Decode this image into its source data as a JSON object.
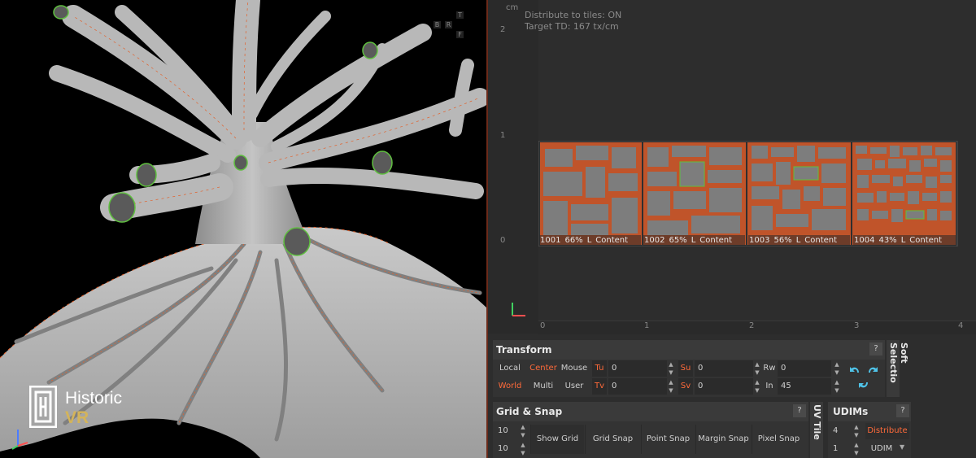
{
  "brand": {
    "name_line1": "Historic",
    "name_line2": "VR"
  },
  "viewport3d": {
    "corner_buttons": [
      "B",
      "T",
      "F",
      "R"
    ],
    "axis_icon": "xyz-axis-icon"
  },
  "uv_editor": {
    "unit_label": "cm",
    "info_lines": [
      "Distribute to tiles: ON",
      "Target TD: 167 tx/cm"
    ],
    "v_ticks": [
      "2",
      "1",
      "0"
    ],
    "u_ticks": [
      "0",
      "1",
      "2",
      "3",
      "4"
    ],
    "tiles": [
      {
        "id": "1001",
        "pct": "66%",
        "flag": "L",
        "name": "Content"
      },
      {
        "id": "1002",
        "pct": "65%",
        "flag": "L",
        "name": "Content"
      },
      {
        "id": "1003",
        "pct": "56%",
        "flag": "L",
        "name": "Content"
      },
      {
        "id": "1004",
        "pct": "43%",
        "flag": "L",
        "name": "Content"
      }
    ],
    "colors": {
      "island_fill": "#7d7d7d",
      "seam": "#e2622d",
      "selection": "#5fbf3f",
      "background": "#2d2d2d"
    }
  },
  "transform_panel": {
    "title": "Transform",
    "help": "?",
    "row1": {
      "space": "Local",
      "pivot": "Center",
      "mode": "Mouse",
      "tu_label": "Tu",
      "tu_value": "0",
      "su_label": "Su",
      "su_value": "0",
      "rw_label": "Rw",
      "rw_value": "0"
    },
    "row2": {
      "space": "World",
      "pivot": "Multi",
      "mode": "User",
      "tv_label": "Tv",
      "tv_value": "0",
      "sv_label": "Sv",
      "sv_value": "0",
      "in_label": "In",
      "in_value": "45"
    },
    "side_tab": "Soft Selectio"
  },
  "grid_snap_panel": {
    "title": "Grid & Snap",
    "help": "?",
    "grid_u": "10",
    "grid_v": "10",
    "buttons": [
      "Show Grid",
      "Grid Snap",
      "Point Snap",
      "Margin Snap",
      "Pixel Snap"
    ],
    "side_tab": "UV Tile"
  },
  "udims_panel": {
    "title": "UDIMs",
    "help": "?",
    "count": "4",
    "distribute_label": "Distribute",
    "start": "1",
    "mode": "UDIM"
  }
}
